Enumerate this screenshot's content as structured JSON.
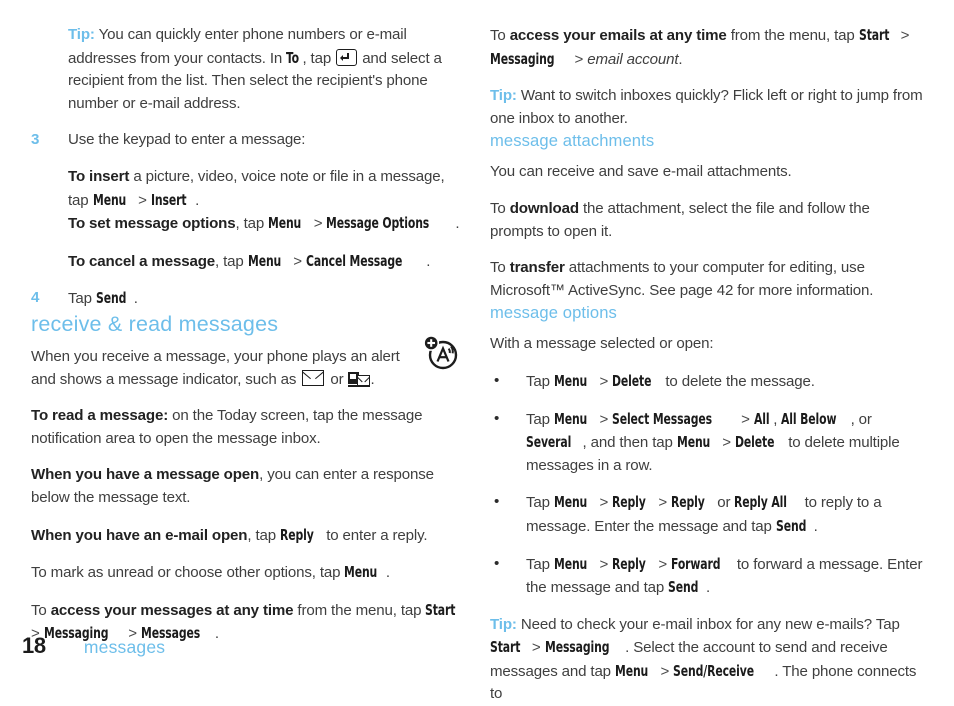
{
  "page": {
    "number": "18",
    "running_head": "messages",
    "accent_color": "#6DBEEA",
    "text_color": "#3f3f3f"
  },
  "left_column": {
    "tip_1": {
      "label": "Tip:",
      "part_1": "You can quickly enter phone numbers or e-mail addresses from your contacts. In",
      "ui_to": "To",
      "part_2": ", tap",
      "icon": "enter-key-icon",
      "part_3": "and select a recipient from the list. Then select the recipient's phone number or e-mail address."
    },
    "step_3": {
      "number": "3",
      "text": "Use the keypad to enter a message:",
      "insert": {
        "bold": "To insert",
        "mid": "a picture, video, voice note or file in a message, tap",
        "ui_1": "Menu",
        "sep": ">",
        "ui_2": "Insert",
        "end": "."
      },
      "options": {
        "bold": "To set message options",
        "mid": ", tap",
        "ui_1": "Menu",
        "sep": ">",
        "ui_2": "Message Options",
        "end": "."
      },
      "cancel": {
        "bold": "To cancel a message",
        "mid": ", tap",
        "ui_1": "Menu",
        "sep": ">",
        "ui_2": "Cancel Message",
        "end": "."
      }
    },
    "step_4": {
      "number": "4",
      "pre": "Tap",
      "ui_1": "Send",
      "end": "."
    },
    "section_heading": "receive & read messages",
    "intro": {
      "part_1": "When you receive a message, your phone plays an alert and shows a message indicator, such as",
      "icon_1": "envelope-icon",
      "part_2": "or",
      "icon_2": "mms-indicator-icon",
      "part_3": "."
    },
    "margin_icon": "alert-add-icon",
    "read_message": {
      "bold": "To read a message:",
      "rest": "on the Today screen, tap the message notification area to open the message inbox."
    },
    "message_open": {
      "bold": "When you have a message open",
      "rest": ", you can enter a response below the message text."
    },
    "email_open": {
      "bold": "When you have an e-mail open",
      "mid": ", tap",
      "ui_1": "Reply",
      "rest": "to enter a reply."
    },
    "mark_unread": {
      "pre": "To mark as unread or choose other options, tap",
      "ui_1": "Menu",
      "end": "."
    },
    "access_messages": {
      "pre": "To",
      "bold": "access your messages at any time",
      "mid": "from the menu, tap",
      "ui_1": "Start",
      "sep_1": ">",
      "ui_2": "Messaging",
      "sep_2": ">",
      "ui_3": "Messages",
      "end": "."
    }
  },
  "right_column": {
    "access_emails": {
      "pre": "To",
      "bold": "access your emails at any time",
      "mid": "from the menu, tap",
      "ui_1": "Start",
      "sep_1": ">",
      "ui_2": "Messaging",
      "sep_2": ">",
      "italic": "email account",
      "end": "."
    },
    "tip_inboxes": {
      "label": "Tip:",
      "text": "Want to switch inboxes quickly? Flick left or right to jump from one inbox to another."
    },
    "attachments": {
      "heading": "message attachments",
      "intro": "You can receive and save e-mail attachments.",
      "download": {
        "pre": "To",
        "bold": "download",
        "rest": "the attachment, select the file and follow the prompts to open it."
      },
      "transfer": {
        "pre": "To",
        "bold": "transfer",
        "rest": "attachments to your computer for editing, use Microsoft™ ActiveSync. See page 42 for more information."
      }
    },
    "options": {
      "heading": "message options",
      "intro": "With a message selected or open:",
      "bullets": [
        {
          "pre": "Tap",
          "ui_1": "Menu",
          "sep_1": ">",
          "ui_2": "Delete",
          "rest": "to delete the message."
        },
        {
          "pre": "Tap",
          "ui_1": "Menu",
          "sep_1": ">",
          "ui_2": "Select Messages",
          "sep_2": ">",
          "ui_3": "All",
          "comma_1": ",",
          "ui_4": "All Below",
          "mid": ", or",
          "ui_5": "Several",
          "mid_2": ", and then tap",
          "ui_6": "Menu",
          "sep_3": ">",
          "ui_7": "Delete",
          "rest": "to delete multiple messages in a row."
        },
        {
          "pre": "Tap",
          "ui_1": "Menu",
          "sep_1": ">",
          "ui_2": "Reply",
          "sep_2": ">",
          "ui_3": "Reply",
          "mid": "or",
          "ui_4": "Reply All",
          "mid_2": "to reply to a message. Enter the message and tap",
          "ui_5": "Send",
          "rest": "."
        },
        {
          "pre": "Tap",
          "ui_1": "Menu",
          "sep_1": ">",
          "ui_2": "Reply",
          "sep_2": ">",
          "ui_3": "Forward",
          "mid": "to forward a message. Enter the message and tap",
          "ui_4": "Send",
          "rest": "."
        }
      ]
    },
    "tip_check": {
      "label": "Tip:",
      "part_1": "Need to check your e-mail inbox for any new e-mails? Tap",
      "ui_1": "Start",
      "sep_1": ">",
      "ui_2": "Messaging",
      "part_2": ". Select the account to send and receive messages and tap",
      "ui_3": "Menu",
      "sep_2": ">",
      "ui_4": "Send/Receive",
      "part_3": ". The phone connects to"
    }
  }
}
